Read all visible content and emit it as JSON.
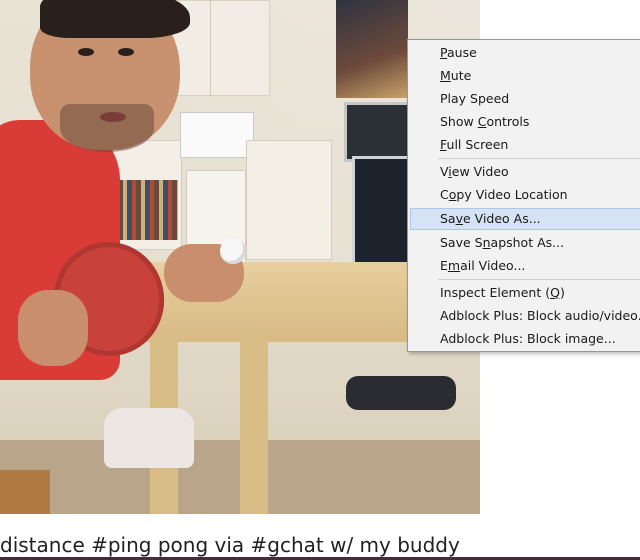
{
  "video": {
    "scene": "frame-illustration"
  },
  "caption": {
    "text": "distance #ping pong via #gchat w/ my buddy"
  },
  "context_menu": {
    "groups": [
      [
        {
          "pre": "",
          "key": "P",
          "post": "ause"
        },
        {
          "pre": "",
          "key": "M",
          "post": "ute"
        },
        {
          "pre": "Play Speed",
          "key": "",
          "post": ""
        },
        {
          "pre": "Show ",
          "key": "C",
          "post": "ontrols"
        },
        {
          "pre": "",
          "key": "F",
          "post": "ull Screen"
        }
      ],
      [
        {
          "pre": "V",
          "key": "i",
          "post": "ew Video"
        },
        {
          "pre": "C",
          "key": "o",
          "post": "py Video Location"
        },
        {
          "pre": "Sa",
          "key": "v",
          "post": "e Video As..."
        },
        {
          "pre": "Save S",
          "key": "n",
          "post": "apshot As..."
        },
        {
          "pre": "E",
          "key": "m",
          "post": "ail Video..."
        }
      ],
      [
        {
          "pre": "Inspect Element (",
          "key": "Q",
          "post": ")"
        },
        {
          "pre": "Adblock Plus: Block audio/video...",
          "key": "",
          "post": ""
        },
        {
          "pre": "Adblock Plus: Block image...",
          "key": "",
          "post": ""
        }
      ]
    ],
    "highlighted": "Save Video As..."
  }
}
